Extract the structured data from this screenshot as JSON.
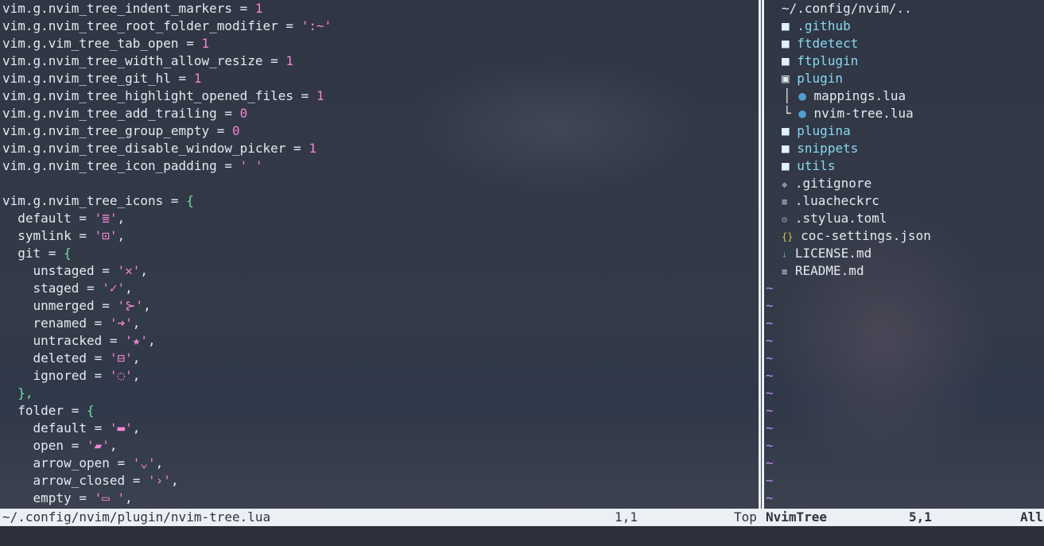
{
  "editor": {
    "settings": [
      {
        "key": "vim.g.nvim_tree_indent_markers = ",
        "val": "1",
        "kind": "num"
      },
      {
        "key": "vim.g.nvim_tree_root_folder_modifier = ",
        "val": "':~'",
        "kind": "str"
      },
      {
        "key": "vim.g.vim_tree_tab_open = ",
        "val": "1",
        "kind": "num"
      },
      {
        "key": "vim.g.nvim_tree_width_allow_resize = ",
        "val": "1",
        "kind": "num"
      },
      {
        "key": "vim.g.nvim_tree_git_hl = ",
        "val": "1",
        "kind": "num"
      },
      {
        "key": "vim.g.nvim_tree_highlight_opened_files = ",
        "val": "1",
        "kind": "num"
      },
      {
        "key": "vim.g.nvim_tree_add_trailing = ",
        "val": "0",
        "kind": "num"
      },
      {
        "key": "vim.g.nvim_tree_group_empty = ",
        "val": "0",
        "kind": "num"
      },
      {
        "key": "vim.g.nvim_tree_disable_window_picker = ",
        "val": "1",
        "kind": "num"
      },
      {
        "key": "vim.g.nvim_tree_icon_padding = ",
        "val": "' '",
        "kind": "str"
      }
    ],
    "icons_open": "vim.g.nvim_tree_icons = ",
    "brace_open": "{",
    "default_key": "  default = ",
    "default_val": "'≣'",
    "symlink_key": "  symlink = ",
    "symlink_val": "'⊡'",
    "git_key": "  git = ",
    "git_items": [
      {
        "key": "    unstaged = ",
        "val": "'✕'"
      },
      {
        "key": "    staged = ",
        "val": "'✓'"
      },
      {
        "key": "    unmerged = ",
        "val": "'⊱'"
      },
      {
        "key": "    renamed = ",
        "val": "'➜'"
      },
      {
        "key": "    untracked = ",
        "val": "'★'"
      },
      {
        "key": "    deleted = ",
        "val": "'⊟'"
      },
      {
        "key": "    ignored = ",
        "val": "'◌'"
      }
    ],
    "git_close": "  },",
    "folder_key": "  folder = ",
    "folder_items": [
      {
        "key": "    default = ",
        "val": "'▬'"
      },
      {
        "key": "    open = ",
        "val": "'▰'"
      },
      {
        "key": "    arrow_open = ",
        "val": "'⌄'"
      },
      {
        "key": "    arrow_closed = ",
        "val": "'›'"
      },
      {
        "key": "    empty = ",
        "val": "'▭ '"
      }
    ],
    "comma": ","
  },
  "tree": {
    "root": "~/.config/nvim/..",
    "dirs_top": [
      ".github",
      "ftdetect",
      "ftplugin"
    ],
    "plugin_dir": "plugin",
    "plugin_children": [
      "mappings.lua",
      "nvim-tree.lua"
    ],
    "dirs_bottom": [
      "plugina",
      "snippets",
      "utils"
    ],
    "files": [
      {
        "icon": "◆",
        "name": ".gitignore",
        "cls": "muted"
      },
      {
        "icon": "≡",
        "name": ".luacheckrc",
        "cls": "file"
      },
      {
        "icon": "⚙",
        "name": ".stylua.toml",
        "cls": "muted"
      },
      {
        "icon": "{}",
        "name": "coc-settings.json",
        "cls": "json-icon"
      },
      {
        "icon": "↓",
        "name": "LICENSE.md",
        "cls": "md-icon"
      },
      {
        "icon": "≡",
        "name": "README.md",
        "cls": "file"
      }
    ],
    "dir_icon": "■",
    "lua_icon": "●",
    "tilde": "~",
    "tilde_count": 13
  },
  "statusline": {
    "path": "~/.config/nvim/plugin/nvim-tree.lua",
    "position": "1,1",
    "scroll": "Top",
    "tree_name": "NvimTree",
    "tree_position": "5,1",
    "tree_scroll": "All"
  }
}
